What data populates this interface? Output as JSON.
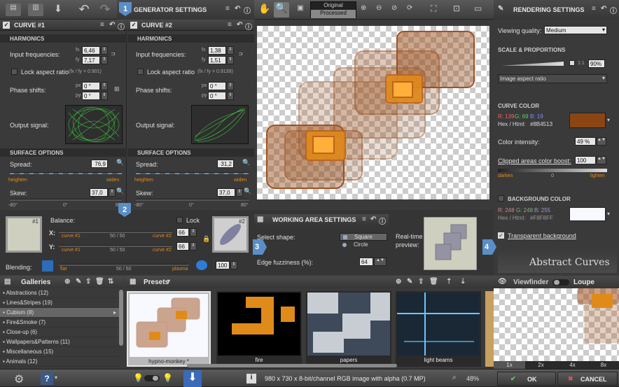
{
  "toolbar": {
    "original": "Original",
    "processed": "Processed"
  },
  "generator": {
    "title": "GENERATOR SETTINGS",
    "badge": "1"
  },
  "curve1": {
    "title": "CURVE #1",
    "harmonics": "HARMONICS",
    "input_freq": "Input frequencies:",
    "fx_label": "fx",
    "fy_label": "fy",
    "fx": "6,46",
    "fy": "7,17",
    "lock_aspect": "Lock aspect ratio",
    "ratio": "(fx / fy = 0.901)",
    "phase": "Phase shifts:",
    "px_label": "px",
    "py_label": "py",
    "px": "0 °",
    "py": "0 °",
    "output": "Output signal:",
    "surface": "SURFACE OPTIONS",
    "spread": "Spread:",
    "spread_val": "76,9",
    "heighten": "heighten",
    "widen": "widen",
    "skew": "Skew:",
    "skew_val": "37,0 °",
    "ticks": [
      "-80°",
      "0°",
      "80°"
    ]
  },
  "curve2": {
    "title": "CURVE #2",
    "harmonics": "HARMONICS",
    "input_freq": "Input frequencies:",
    "fx_label": "fx",
    "fy_label": "fy",
    "fx": "1,38",
    "fy": "1,51",
    "lock_aspect": "Lock aspect ratio",
    "ratio": "(fx / fy = 0.9139)",
    "phase": "Phase shifts:",
    "px_label": "px",
    "py_label": "py",
    "px": "0 °",
    "py": "0 °",
    "output": "Output signal:",
    "surface": "SURFACE OPTIONS",
    "spread": "Spread:",
    "spread_val": "31,2",
    "heighten": "heighten",
    "widen": "widen",
    "skew": "Skew:",
    "skew_val": "37,0 °",
    "ticks": [
      "-80°",
      "0°",
      "80°"
    ]
  },
  "balance": {
    "badge": "2",
    "title": "Balance:",
    "lock": "Lock",
    "x_label": "X:",
    "y_label": "Y:",
    "curve1": "curve #1",
    "curve2": "curve #2",
    "x_ratio": "50 / 50",
    "y_ratio": "50 / 50",
    "x_val": "66",
    "y_val": "66",
    "blending": "Blending:",
    "flat": "flat",
    "plasma": "plasma",
    "blend_ratio": "50 / 50",
    "blend_val": "100",
    "thumb1_num": "#1",
    "thumb2_num": "#2"
  },
  "working": {
    "badge": "3",
    "title": "WORKING AREA SETTINGS",
    "select_shape": "Select shape:",
    "square": "Square",
    "circle": "Circle",
    "fuzz": "Edge fuzziness (%):",
    "fuzz_val": "64",
    "preview": "Real-time preview:"
  },
  "rendering": {
    "title": "RENDERING SETTINGS",
    "badge": "4",
    "view_quality": "Viewing quality:",
    "quality_val": "Medium",
    "scale": "SCALE & PROPORTIONS",
    "one_to_one": "1:1",
    "zoom": "90%",
    "aspect": "Image aspect ratio",
    "curve_color": "CURVE COLOR",
    "r": "R: 139",
    "g": "G: 69",
    "b": "B: 19",
    "hex": "Hex / Html:",
    "hex_val": "#8B4513",
    "curve_swatch": "#8B4513",
    "intensity": "Color intensity:",
    "intensity_val": "49 %",
    "clipped": "Clipped areas color boost:",
    "clipped_val": "100",
    "darken": "darken",
    "zero": "0",
    "lighten": "lighten",
    "bg_color": "BACKGROUND COLOR",
    "bg_r": "R: 248",
    "bg_g": "G: 248",
    "bg_b": "B: 255",
    "bg_hex": "Hex / Html:",
    "bg_hex_val": "#F8F8FF",
    "bg_swatch": "#F8F8FF",
    "transparent": "Transparent background",
    "logo": "Abstract Curves"
  },
  "galleries": {
    "title": "Galleries",
    "items": [
      "Abstractions (12)",
      "Lines&Stripes (19)",
      "Cubism (8)",
      "Fire&Smoke (7)",
      "Close-up (6)",
      "Wallpapers&Patterns (11)",
      "Miscellaneous (15)",
      "Animals (12)"
    ]
  },
  "presets": {
    "title": "Presets",
    "items": [
      "hypno-monkey *",
      "fire",
      "papers",
      "light beams"
    ]
  },
  "viewfinder": {
    "title": "Viewfinder",
    "loupe": "Loupe",
    "zooms": [
      "1x",
      "2x",
      "4x",
      "8x"
    ]
  },
  "status": {
    "info": "980 x 730 x 8-bit/channel RGB image with alpha  (0.7 MP)",
    "zoom": "48%",
    "ok": "OK",
    "cancel": "CANCEL"
  }
}
